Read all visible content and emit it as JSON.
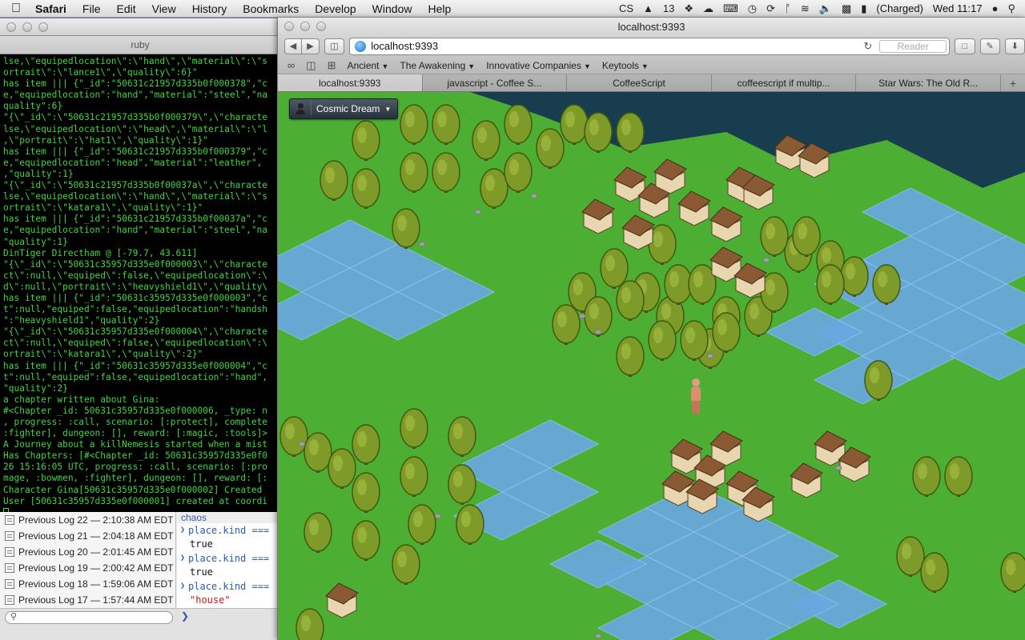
{
  "menubar": {
    "apple": "",
    "app": "Safari",
    "items": [
      "File",
      "Edit",
      "View",
      "History",
      "Bookmarks",
      "Develop",
      "Window",
      "Help"
    ],
    "status": {
      "cs": "CS",
      "adobe": "13",
      "battery": "(Charged)",
      "clock": "Wed 11:17"
    }
  },
  "terminal": {
    "title": "",
    "tab": "ruby",
    "lines": [
      "lse,\\\"equipedlocation\\\":\\\"hand\\\",\\\"material\\\":\\\"s",
      "ortrait\\\":\\\"lance1\\\",\\\"quality\\\":6}\"",
      "has item ||| {\"_id\":\"50631c21957d335b0f000378\",\"c",
      "e,\"equipedlocation\":\"hand\",\"material\":\"steel\",\"na",
      "quality\":6}",
      "\"{\\\"_id\\\":\\\"50631c21957d335b0f000379\\\",\\\"characte",
      "lse,\\\"equipedlocation\\\":\\\"head\\\",\\\"material\\\":\\\"l",
      ",\\\"portrait\\\":\\\"hat1\\\",\\\"quality\\\":1}\"",
      "has item ||| {\"_id\":\"50631c21957d335b0f000379\",\"c",
      "e,\"equipedlocation\":\"head\",\"material\":\"leather\",",
      ",\"quality\":1}",
      "\"{\\\"_id\\\":\\\"50631c21957d335b0f00037a\\\",\\\"characte",
      "lse,\\\"equipedlocation\\\":\\\"hand\\\",\\\"material\\\":\\\"s",
      "ortrait\\\":\\\"katara1\\\",\\\"quality\\\":1}\"",
      "has item ||| {\"_id\":\"50631c21957d335b0f00037a\",\"c",
      "e,\"equipedlocation\":\"hand\",\"material\":\"steel\",\"na",
      "\"quality\":1}",
      "DinTiger Directham @ [-79.7, 43.611]",
      "\"{\\\"_id\\\":\\\"50631c35957d335e0f000003\\\",\\\"characte",
      "ct\\\":null,\\\"equiped\\\":false,\\\"equipedlocation\\\":\\",
      "d\\\":null,\\\"portrait\\\":\\\"heavyshield1\\\",\\\"quality\\",
      "has item ||| {\"_id\":\"50631c35957d335e0f000003\",\"c",
      "t\":null,\"equiped\":false,\"equipedlocation\":\"handsh",
      "\":\"heavyshield1\",\"quality\":2}",
      "\"{\\\"_id\\\":\\\"50631c35957d335e0f000004\\\",\\\"characte",
      "ct\\\":null,\\\"equiped\\\":false,\\\"equipedlocation\\\":\\",
      "ortrait\\\":\\\"katara1\\\",\\\"quality\\\":2}\"",
      "has item ||| {\"_id\":\"50631c35957d335e0f000004\",\"c",
      "t\":null,\"equiped\":false,\"equipedlocation\":\"hand\",",
      "\"quality\":2}",
      "a chapter written about Gina:",
      "#<Chapter _id: 50631c35957d335e0f000006, _type: n",
      ", progress: :call, scenario: [:protect], complete",
      ":fighter], dungeon: [], reward: [:magic, :tools]>",
      "A Journey about a killNemesis started when a mist",
      "Has Chapters: [#<Chapter _id: 50631c35957d335e0f0",
      "26 15:16:05 UTC, progress: :call, scenario: [:pro",
      "mage, :bowmen, :fighter], dungeon: [], reward: [:",
      "Character Gina[50631c35957d335e0f000002] Created",
      "User [50631c35957d335e0f000001] created at coordi"
    ]
  },
  "inspector": {
    "logs": [
      "Previous Log 22 — 2:10:38 AM EDT",
      "Previous Log 21 — 2:04:18 AM EDT",
      "Previous Log 20 — 2:01:45 AM EDT",
      "Previous Log 19 — 2:00:42 AM EDT",
      "Previous Log 18 — 1:59:06 AM EDT",
      "Previous Log 17 — 1:57:44 AM EDT"
    ],
    "console": [
      {
        "kind": "in",
        "text": "place.kind === "
      },
      {
        "kind": "out",
        "text": "true"
      },
      {
        "kind": "in",
        "text": "place.kind === "
      },
      {
        "kind": "out",
        "text": "true"
      },
      {
        "kind": "in",
        "text": "place.kind === "
      },
      {
        "kind": "str",
        "text": "\"house\""
      }
    ],
    "console_top_fragment": "chaos"
  },
  "safari": {
    "title": "localhost:9393",
    "url": "localhost:9393",
    "reader": "Reader",
    "bookmarks": [
      "Ancient",
      "The Awakening",
      "Innovative Companies",
      "Keytools"
    ],
    "tabs": [
      {
        "label": "localhost:9393",
        "active": true
      },
      {
        "label": "javascript - Coffee S...",
        "active": false
      },
      {
        "label": "CoffeeScript",
        "active": false
      },
      {
        "label": "coffeescript if multip...",
        "active": false
      },
      {
        "label": "Star Wars: The Old R...",
        "active": false
      }
    ]
  },
  "game": {
    "world_selector": "Cosmic Dream",
    "colors": {
      "grass": "#4caf33",
      "water": "#6aa8e0",
      "sea": "#173d4f",
      "tree": "#7e9b2a"
    }
  }
}
